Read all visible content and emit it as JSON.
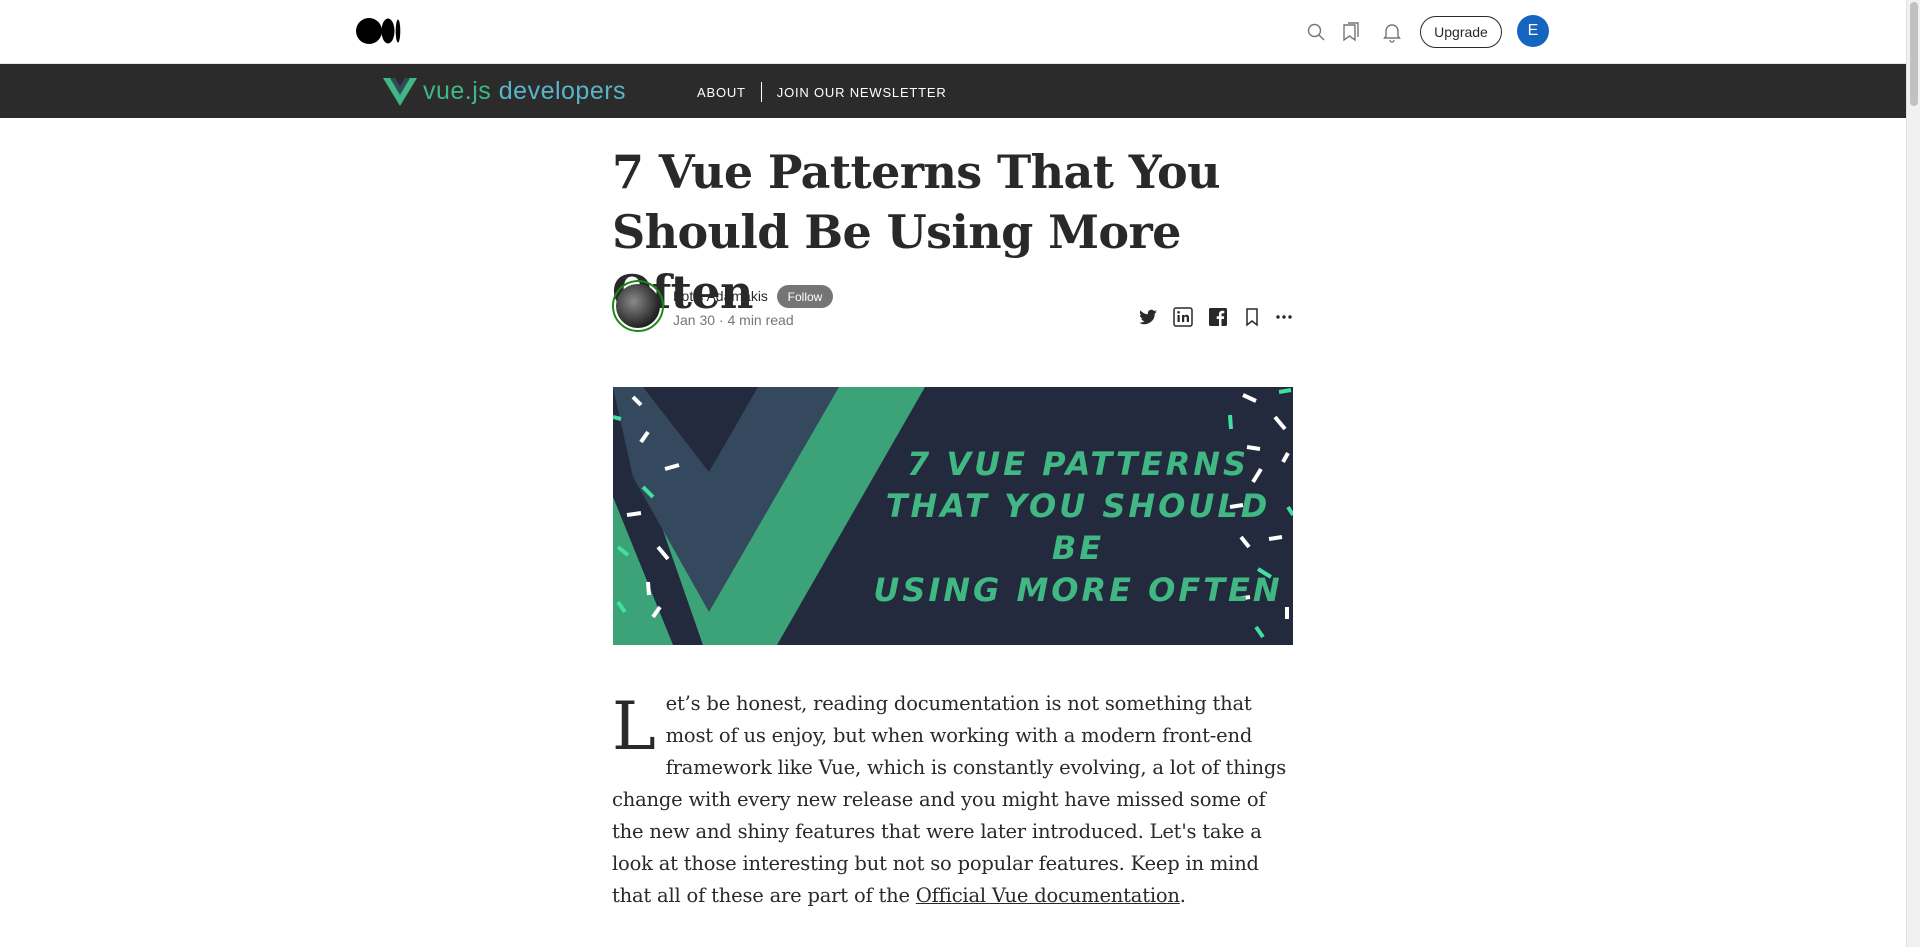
{
  "topbar": {
    "logo_icon": "medium-logo",
    "upgrade_label": "Upgrade",
    "avatar_initial": "E",
    "icons": [
      "search-icon",
      "bookmarks-icon",
      "notifications-icon"
    ]
  },
  "publication": {
    "logo_text_main": "vue.js",
    "logo_text_secondary": " developers",
    "nav": [
      "About",
      "Join our newsletter"
    ]
  },
  "article": {
    "title": "7 Vue Patterns That You Should Be Using More Often",
    "author": "Fotis Adamakis",
    "follow_label": "Follow",
    "meta": "Jan 30 · 4 min read",
    "hero_lines": [
      "7 VUE PATTERNS",
      "THAT YOU SHOULD BE",
      "USING MORE OFTEN"
    ],
    "dropcap": "L",
    "body_before_link": "et’s be honest, reading documentation is not something that most of us enjoy, but when working with a modern front-end framework like Vue, which is constantly evolving, a lot of things change with every new release and you might have missed some of the new and shiny features that were later introduced. Let's take a look at those interesting but not so popular features. Keep in mind that all of these are part of the ",
    "body_link": "Official Vue documentation",
    "body_after_link": "."
  },
  "colors": {
    "accent_green": "#41b883",
    "pub_bar": "#2b2b2b",
    "avatar_blue": "#1565c0",
    "hero_bg": "#232a3e"
  }
}
